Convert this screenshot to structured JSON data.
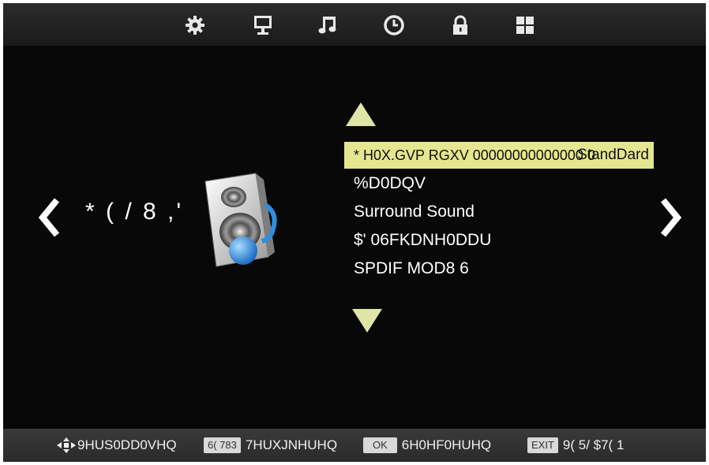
{
  "top_menu": {
    "items": [
      {
        "icon": "gear-icon"
      },
      {
        "icon": "monitor-icon"
      },
      {
        "icon": "music-note-icon"
      },
      {
        "icon": "clock-icon"
      },
      {
        "icon": "lock-icon"
      },
      {
        "icon": "grid-icon"
      }
    ]
  },
  "category": {
    "label": "* ( / 8 ,'",
    "icon": "speaker-icon"
  },
  "menu": {
    "items": [
      {
        "label": "* H0X.GVP RGXV  00000000000000 0",
        "value": "StandDard",
        "selected": true
      },
      {
        "label": "%D0DQV"
      },
      {
        "label": "Surround Sound"
      },
      {
        "label": "$'  06FKDNH0DDU"
      },
      {
        "label": "SPDIF MOD8 6"
      }
    ]
  },
  "bottom_hints": {
    "move": {
      "icon": "dpad-arrows-icon",
      "text": "9HUS0DD0VHQ"
    },
    "setup": {
      "key": "6( 783",
      "text": "7HUXJNHUHQ"
    },
    "ok": {
      "key": "OK",
      "text": "6H0HF0HUHQ"
    },
    "exit": {
      "key": "EXIT",
      "text": "9( 5/ $7( 1"
    }
  },
  "colors": {
    "background": "#080808",
    "highlight": "#e5e690",
    "triangle": "#dfe5a6",
    "bar": "#2a2a2a"
  }
}
